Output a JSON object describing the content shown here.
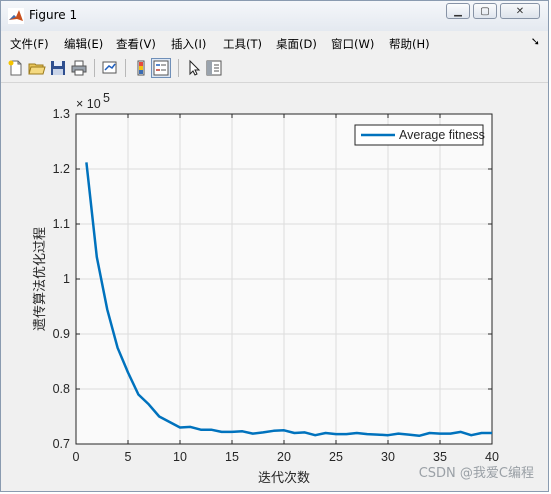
{
  "window": {
    "title": "Figure 1"
  },
  "menu": {
    "items": [
      "文件(F)",
      "编辑(E)",
      "查看(V)",
      "插入(I)",
      "工具(T)",
      "桌面(D)",
      "窗口(W)",
      "帮助(H)"
    ],
    "arrow": "➘"
  },
  "toolbar": {
    "icons": [
      "new-figure-icon",
      "open-file-icon",
      "save-icon",
      "print-icon",
      "link-plot-icon",
      "insert-colorbar-icon",
      "insert-legend-icon",
      "edit-plot-arrow-icon",
      "property-editor-icon"
    ]
  },
  "watermark": "CSDN @我爱C编程",
  "chart_data": {
    "type": "line",
    "exponent_label_base": "× 10",
    "exponent_label_power": "5",
    "ylabel": "遗传算法优化过程",
    "xlabel": "迭代次数",
    "xlim": [
      0,
      40
    ],
    "ylim": [
      0.7,
      1.3
    ],
    "xticks": [
      0,
      5,
      10,
      15,
      20,
      25,
      30,
      35,
      40
    ],
    "yticks": [
      0.7,
      0.8,
      0.9,
      1.0,
      1.1,
      1.2,
      1.3
    ],
    "ytick_labels": [
      "0.7",
      "0.8",
      "0.9",
      "1",
      "1.1",
      "1.2",
      "1.3"
    ],
    "grid": true,
    "legend_position": "top-right",
    "line_color": "#0072bd",
    "series": [
      {
        "name": "Average fitness",
        "x": [
          1,
          2,
          3,
          4,
          5,
          6,
          7,
          8,
          9,
          10,
          11,
          12,
          13,
          14,
          15,
          16,
          17,
          18,
          19,
          20,
          21,
          22,
          23,
          24,
          25,
          26,
          27,
          28,
          29,
          30,
          31,
          32,
          33,
          34,
          35,
          36,
          37,
          38,
          39,
          40
        ],
        "values": [
          1.212,
          1.04,
          0.945,
          0.875,
          0.83,
          0.79,
          0.772,
          0.75,
          0.74,
          0.73,
          0.731,
          0.726,
          0.726,
          0.722,
          0.722,
          0.723,
          0.719,
          0.721,
          0.724,
          0.725,
          0.72,
          0.721,
          0.716,
          0.72,
          0.718,
          0.718,
          0.72,
          0.718,
          0.717,
          0.716,
          0.719,
          0.717,
          0.715,
          0.72,
          0.719,
          0.719,
          0.722,
          0.716,
          0.72,
          0.72
        ]
      }
    ]
  }
}
